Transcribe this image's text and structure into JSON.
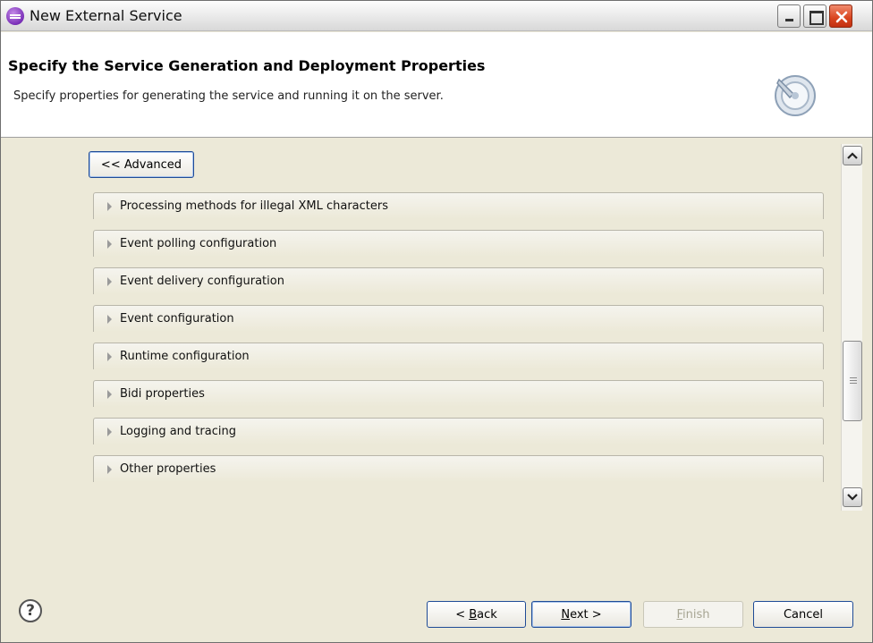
{
  "window": {
    "title": "New External Service"
  },
  "header": {
    "title": "Specify the Service Generation and Deployment Properties",
    "description": "Specify properties for generating the service and running it on the server."
  },
  "content": {
    "advanced_button": "<< Advanced",
    "sections": [
      {
        "label": "Processing methods for illegal XML characters"
      },
      {
        "label": "Event polling configuration"
      },
      {
        "label": "Event delivery configuration"
      },
      {
        "label": "Event configuration"
      },
      {
        "label": "Runtime configuration"
      },
      {
        "label": "Bidi properties"
      },
      {
        "label": "Logging and tracing"
      },
      {
        "label": "Other properties"
      }
    ]
  },
  "footer": {
    "help_icon": "?",
    "back": {
      "mnemonic": "B",
      "rest": "ack",
      "prefix": "< "
    },
    "next": {
      "mnemonic": "N",
      "rest": "ext >"
    },
    "finish": {
      "mnemonic": "F",
      "rest": "inish"
    },
    "cancel": "Cancel"
  },
  "icons": {
    "app": "eclipse-icon",
    "header": "wizard-banner-icon",
    "minimize": "minimize-icon",
    "maximize": "maximize-icon",
    "close": "close-icon"
  },
  "colors": {
    "dialog_background": "#ece9d8",
    "button_border": "#1f4b96",
    "close_button": "#d9441e",
    "disabled_text": "#a7a593"
  }
}
